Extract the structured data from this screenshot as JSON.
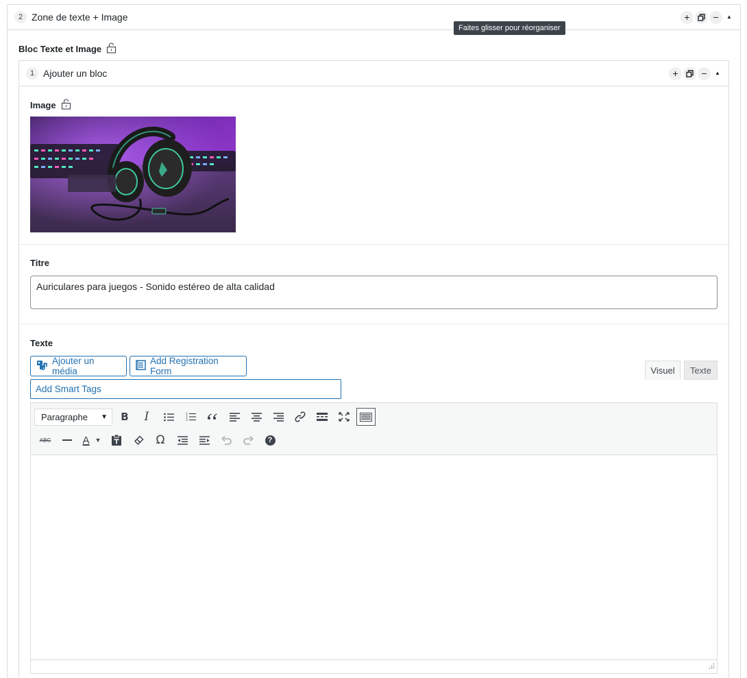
{
  "outer_block": {
    "index": "2",
    "title": "Zone de texte + Image",
    "tooltip": "Faites glisser pour réorganiser"
  },
  "sub_field": {
    "label": "Bloc Texte et Image"
  },
  "inner_block": {
    "index": "1",
    "title": "Ajouter un bloc"
  },
  "image_field": {
    "label": "Image",
    "icon": "headphones-photo"
  },
  "titre_field": {
    "label": "Titre",
    "value": "Auriculares para juegos - Sonido estéreo de alta calidad"
  },
  "texte_field": {
    "label": "Texte",
    "add_media_label": "Ajouter un média",
    "add_registration_label": "Add Registration Form",
    "smart_tags_label": "Add Smart Tags",
    "tab_visual": "Visuel",
    "tab_text": "Texte",
    "format_select": "Paragraphe",
    "toolbar_row1": [
      "bold",
      "italic",
      "bullet-list",
      "numbered-list",
      "blockquote",
      "align-left",
      "align-center",
      "align-right",
      "link",
      "read-more",
      "fullscreen",
      "toolbar-toggle"
    ],
    "toolbar_row2": [
      "strikethrough",
      "horizontal-line",
      "text-color",
      "paste-as-text",
      "clear-formatting",
      "special-character",
      "outdent",
      "indent",
      "undo",
      "redo",
      "help"
    ],
    "glyphs": {
      "bold": "B",
      "italic": "I",
      "strikethrough": "ABC",
      "omega": "Ω",
      "text_color": "A",
      "help": "?"
    }
  },
  "colors": {
    "accent": "#2271b1",
    "border": "#dcdcde",
    "toolbar_bg": "#f6f7f7",
    "tooltip_bg": "#3c434a"
  }
}
